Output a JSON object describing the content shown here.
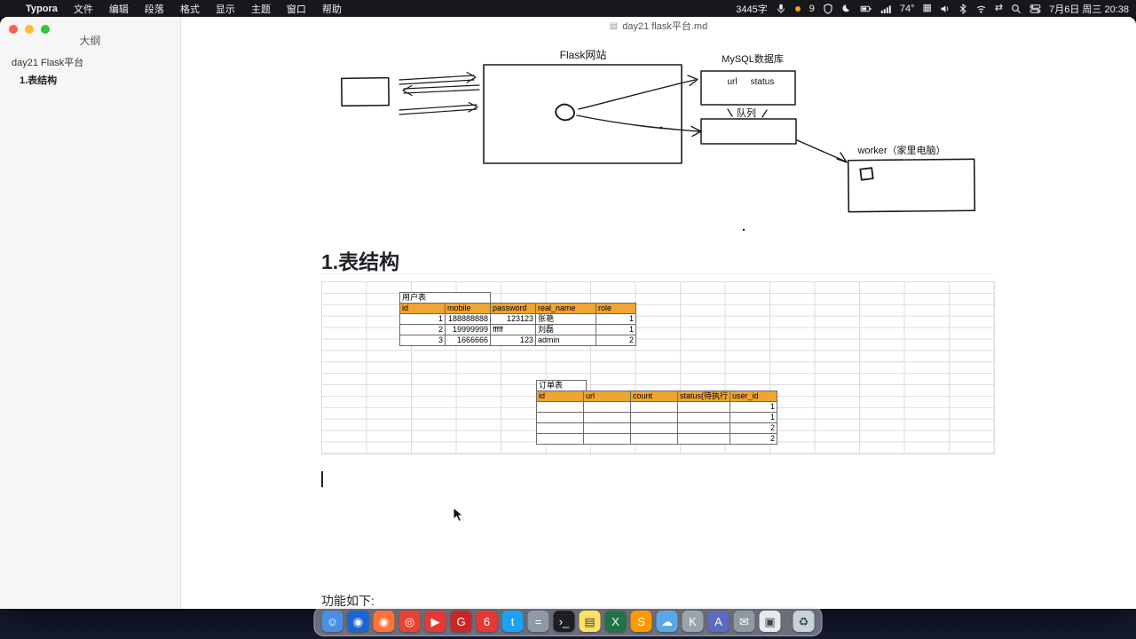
{
  "menubar": {
    "apple": "",
    "app_name": "Typora",
    "menus": [
      "文件",
      "编辑",
      "段落",
      "格式",
      "显示",
      "主题",
      "窗口",
      "帮助"
    ],
    "status": {
      "word_count": "3445字",
      "badge": "9",
      "temperature": "74°",
      "datetime": "7月6日 周三 20:38"
    }
  },
  "sidebar": {
    "panel_title": "大纲",
    "outline": [
      {
        "label": "day21 Flask平台"
      },
      {
        "label": "1.表结构"
      }
    ]
  },
  "editor": {
    "tab_title": "day21 flask平台.md",
    "tab_icon": "▤",
    "heading": "1.表结构",
    "trailing_text": "功能如下:"
  },
  "diagram": {
    "flask_label": "Flask网站",
    "mysql_title": "MySQL数据库",
    "mysql_col_url": "url",
    "mysql_col_status": "status",
    "queue_label": "队列",
    "worker_label": "worker（家里电脑）"
  },
  "user_table": {
    "title": "用户表",
    "headers": [
      "id",
      "mobile",
      "password",
      "real_name",
      "role"
    ],
    "rows": [
      [
        "1",
        "188888888",
        "123123",
        "张艳",
        "1"
      ],
      [
        "2",
        "19999999",
        "fffff",
        "刘磊",
        "1"
      ],
      [
        "3",
        "1666666",
        "123",
        "admin",
        "2"
      ]
    ]
  },
  "order_table": {
    "title": "订单表",
    "headers": [
      "id",
      "url",
      "count",
      "status(待执行",
      "user_id"
    ],
    "rows": [
      [
        "",
        "",
        "",
        "",
        "1"
      ],
      [
        "",
        "",
        "",
        "",
        "1"
      ],
      [
        "",
        "",
        "",
        "",
        "2"
      ],
      [
        "",
        "",
        "",
        "",
        "2"
      ]
    ]
  },
  "dock": {
    "apps": [
      {
        "name": "finder",
        "color": "#4a8fe2",
        "glyph": "☺"
      },
      {
        "name": "safari",
        "color": "#1b66d6",
        "glyph": "◉"
      },
      {
        "name": "firefox",
        "color": "#ff7139",
        "glyph": "◉"
      },
      {
        "name": "chrome",
        "color": "#ea4335",
        "glyph": "◎"
      },
      {
        "name": "video-app",
        "color": "#e53935",
        "glyph": "▶"
      },
      {
        "name": "app-g",
        "color": "#c62828",
        "glyph": "G"
      },
      {
        "name": "app-6",
        "color": "#e53935",
        "glyph": "6"
      },
      {
        "name": "twitter",
        "color": "#1da1f2",
        "glyph": "t"
      },
      {
        "name": "calculator",
        "color": "#8e9aa5",
        "glyph": "="
      },
      {
        "name": "terminal",
        "color": "#1d1f24",
        "glyph": "›_"
      },
      {
        "name": "notes",
        "color": "#ffe066",
        "glyph": "▤",
        "dark": true
      },
      {
        "name": "excel",
        "color": "#217346",
        "glyph": "X"
      },
      {
        "name": "sublime",
        "color": "#ff9800",
        "glyph": "S"
      },
      {
        "name": "weather",
        "color": "#5aa7e8",
        "glyph": "☁"
      },
      {
        "name": "keychain",
        "color": "#9aa4ad",
        "glyph": "K"
      },
      {
        "name": "app-a",
        "color": "#5c6bc0",
        "glyph": "A"
      },
      {
        "name": "mail",
        "color": "#8d9aa3",
        "glyph": "✉"
      },
      {
        "name": "files",
        "color": "#e8ebee",
        "glyph": "▣",
        "dark": true
      },
      {
        "name": "trash",
        "color": "#c9d2d8",
        "glyph": "♻",
        "dark": true,
        "gap": true
      }
    ]
  }
}
